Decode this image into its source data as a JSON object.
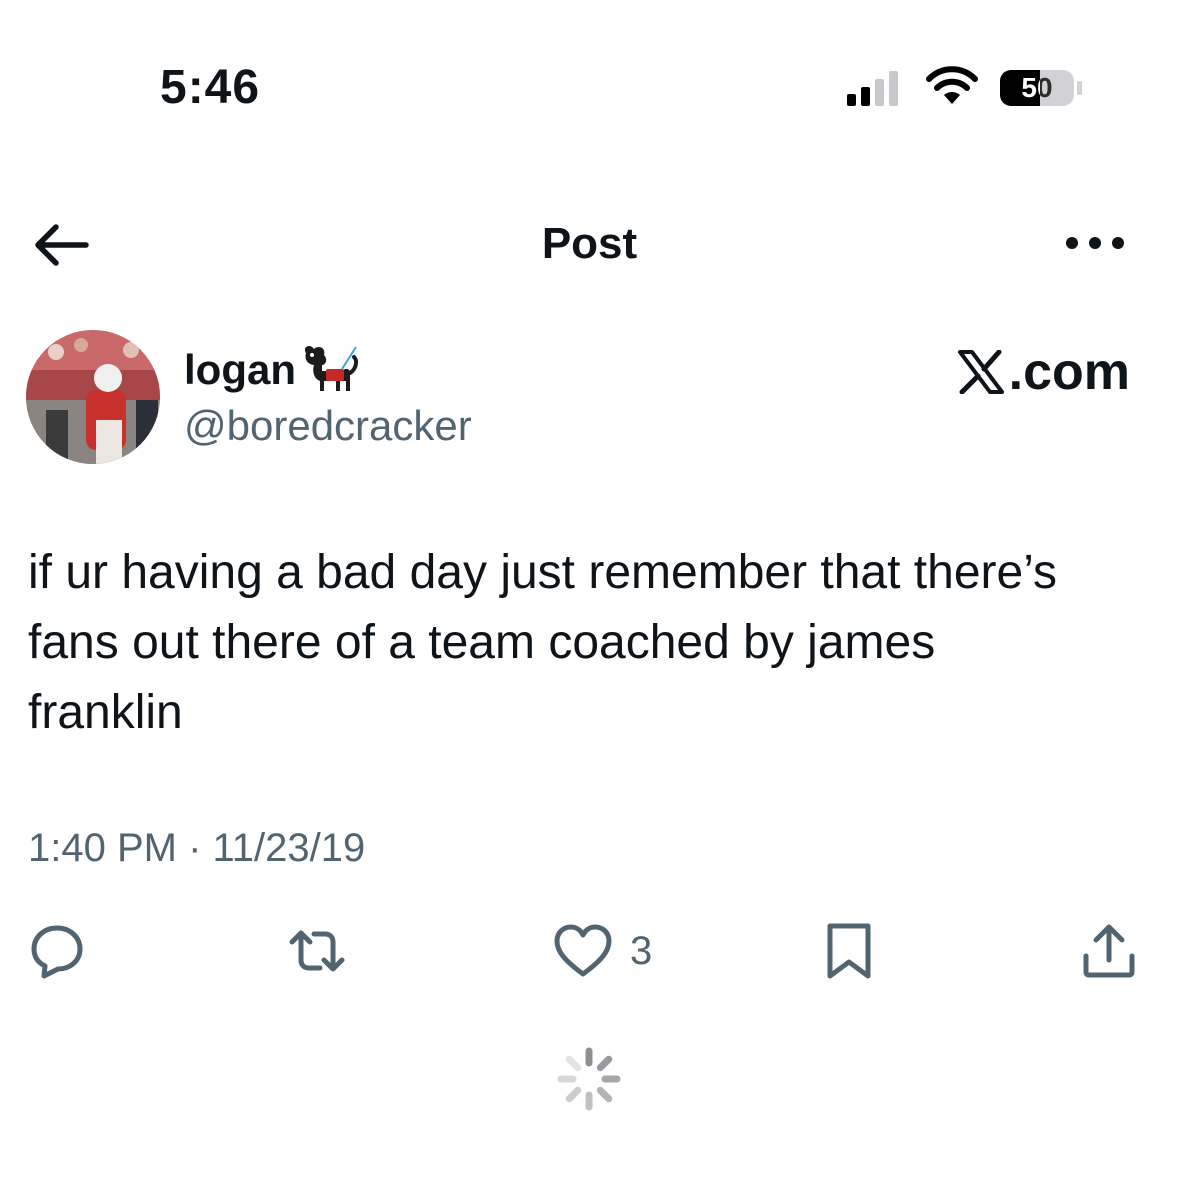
{
  "status_bar": {
    "time": "5:46",
    "battery_level": "50",
    "icons": [
      "cellular-signal-icon",
      "wifi-icon",
      "battery-icon"
    ]
  },
  "header": {
    "title": "Post",
    "back_icon": "arrow-left-icon",
    "more_icon": "more-dots-icon"
  },
  "author": {
    "display_name": "logan",
    "name_emoji": "service-dog-emoji",
    "handle": "@boredcracker",
    "watermark": "X.com"
  },
  "tweet": {
    "text": "if ur having a bad day just remember that there’s\nfans out there of a team coached by james\nfranklin",
    "timestamp": "1:40 PM · 11/23/19"
  },
  "actions": {
    "reply_icon": "reply-bubble-icon",
    "retweet_icon": "retweet-icon",
    "like_icon": "heart-icon",
    "like_count": "3",
    "bookmark_icon": "bookmark-icon",
    "share_icon": "share-icon"
  },
  "colors": {
    "text": "#0f1419",
    "secondary": "#536471",
    "background": "#ffffff"
  }
}
